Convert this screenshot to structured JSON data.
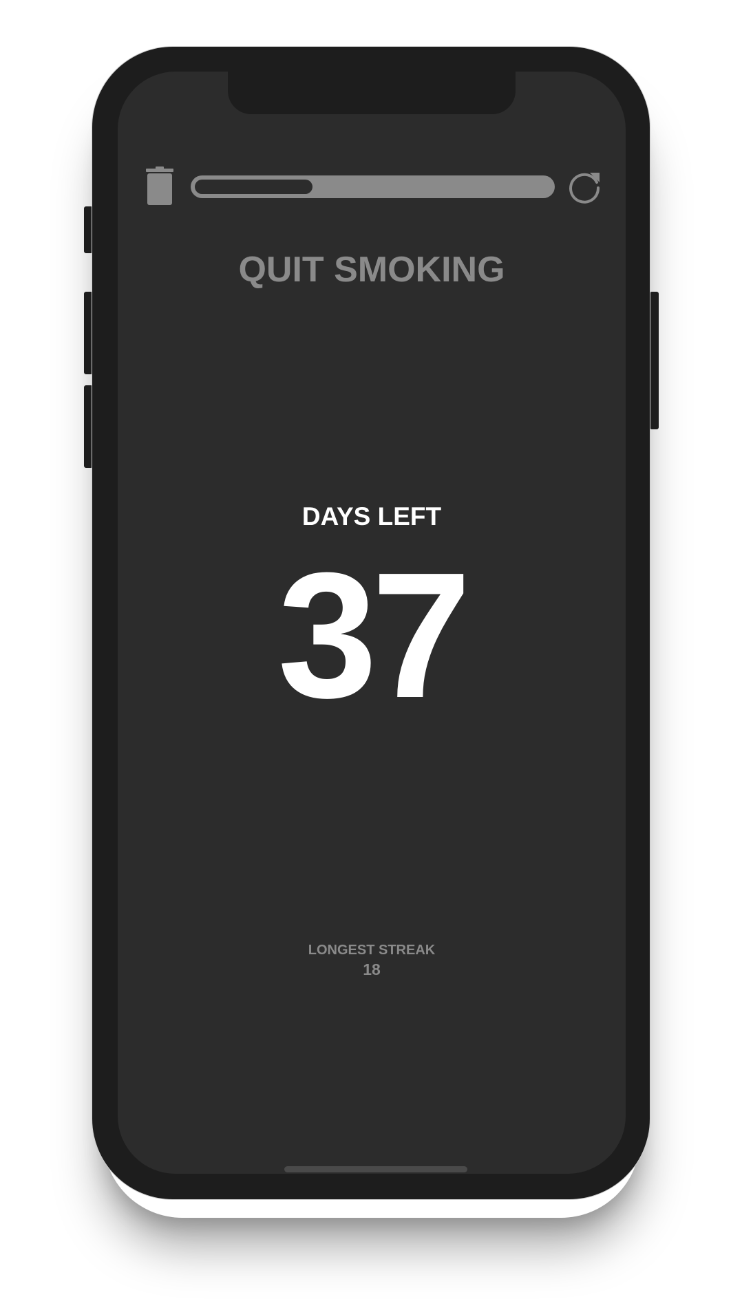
{
  "app": {
    "title": "QUIT SMOKING"
  },
  "toolbar": {
    "delete_icon": "trash-icon",
    "reset_icon": "refresh-icon",
    "progress_fraction": 0.33
  },
  "counter": {
    "label": "DAYS LEFT",
    "value": "37"
  },
  "streak": {
    "label": "LONGEST STREAK",
    "value": "18"
  },
  "colors": {
    "screen_bg": "#2c2c2c",
    "frame": "#1d1d1d",
    "muted_text": "#8a8a8a",
    "primary_text": "#ffffff"
  }
}
